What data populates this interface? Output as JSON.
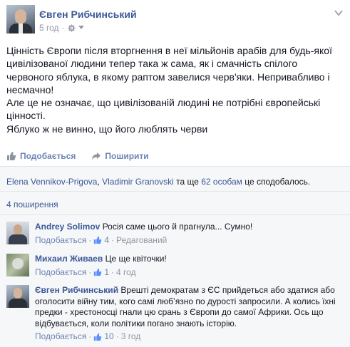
{
  "post": {
    "author": "Євген Рибчинський",
    "time": "5 год",
    "paragraphs": [
      "Цінність Європи після вторгнення в неї мільйонів арабів для будь-якої цивілізованої людини тепер така ж сама, як і смачність спілого червоного яблука, в якому раптом завелися черв'яки. Непривабливо і несмачно!",
      "Але це не означає, що цивілізованій людині не потрібні європейські цінності.",
      "Яблуко ж не винно, що його люблять черви"
    ],
    "actions": {
      "like": "Подобається",
      "share": "Поширити"
    }
  },
  "likes": {
    "name1": "Elena Vennikov-Prigova",
    "sep": ", ",
    "name2": "Vladimir Granovski",
    "mid": " та ще ",
    "others": "62 особам",
    "tail": " це сподобалось."
  },
  "shares": "4 поширення",
  "comments": [
    {
      "author": "Andrey Solimov",
      "text": "Росія саме цього й прагнула... Сумно!",
      "like": "Подобається",
      "count": "4",
      "time": "Редагований"
    },
    {
      "author": "Михаил Живаев",
      "text": "Це ще квіточки!",
      "like": "Подобається",
      "count": "1",
      "time": "4 год"
    },
    {
      "author": "Євген Рибчинський",
      "text": "Врешті демократам з ЄС прийдеться або здатися або оголосити війну тим, кого самі любʼязно по дурості запросили. А колись їхні предки - хрестоносці гнали цю срань з Європи до самої Африки. Ось що відбувається, коли політики погано знають історію.",
      "like": "Подобається",
      "count": "10",
      "time": "3 год"
    }
  ],
  "separator": "·",
  "colors": {
    "link": "#3b5998",
    "muted": "#9197a3",
    "action": "#6d84b4",
    "ufi_bg": "#f6f7f8"
  },
  "icons": {
    "menu": "chevron-down-icon",
    "privacy": "gear-icon",
    "like": "thumbs-up-icon",
    "share": "share-arrow-icon"
  }
}
